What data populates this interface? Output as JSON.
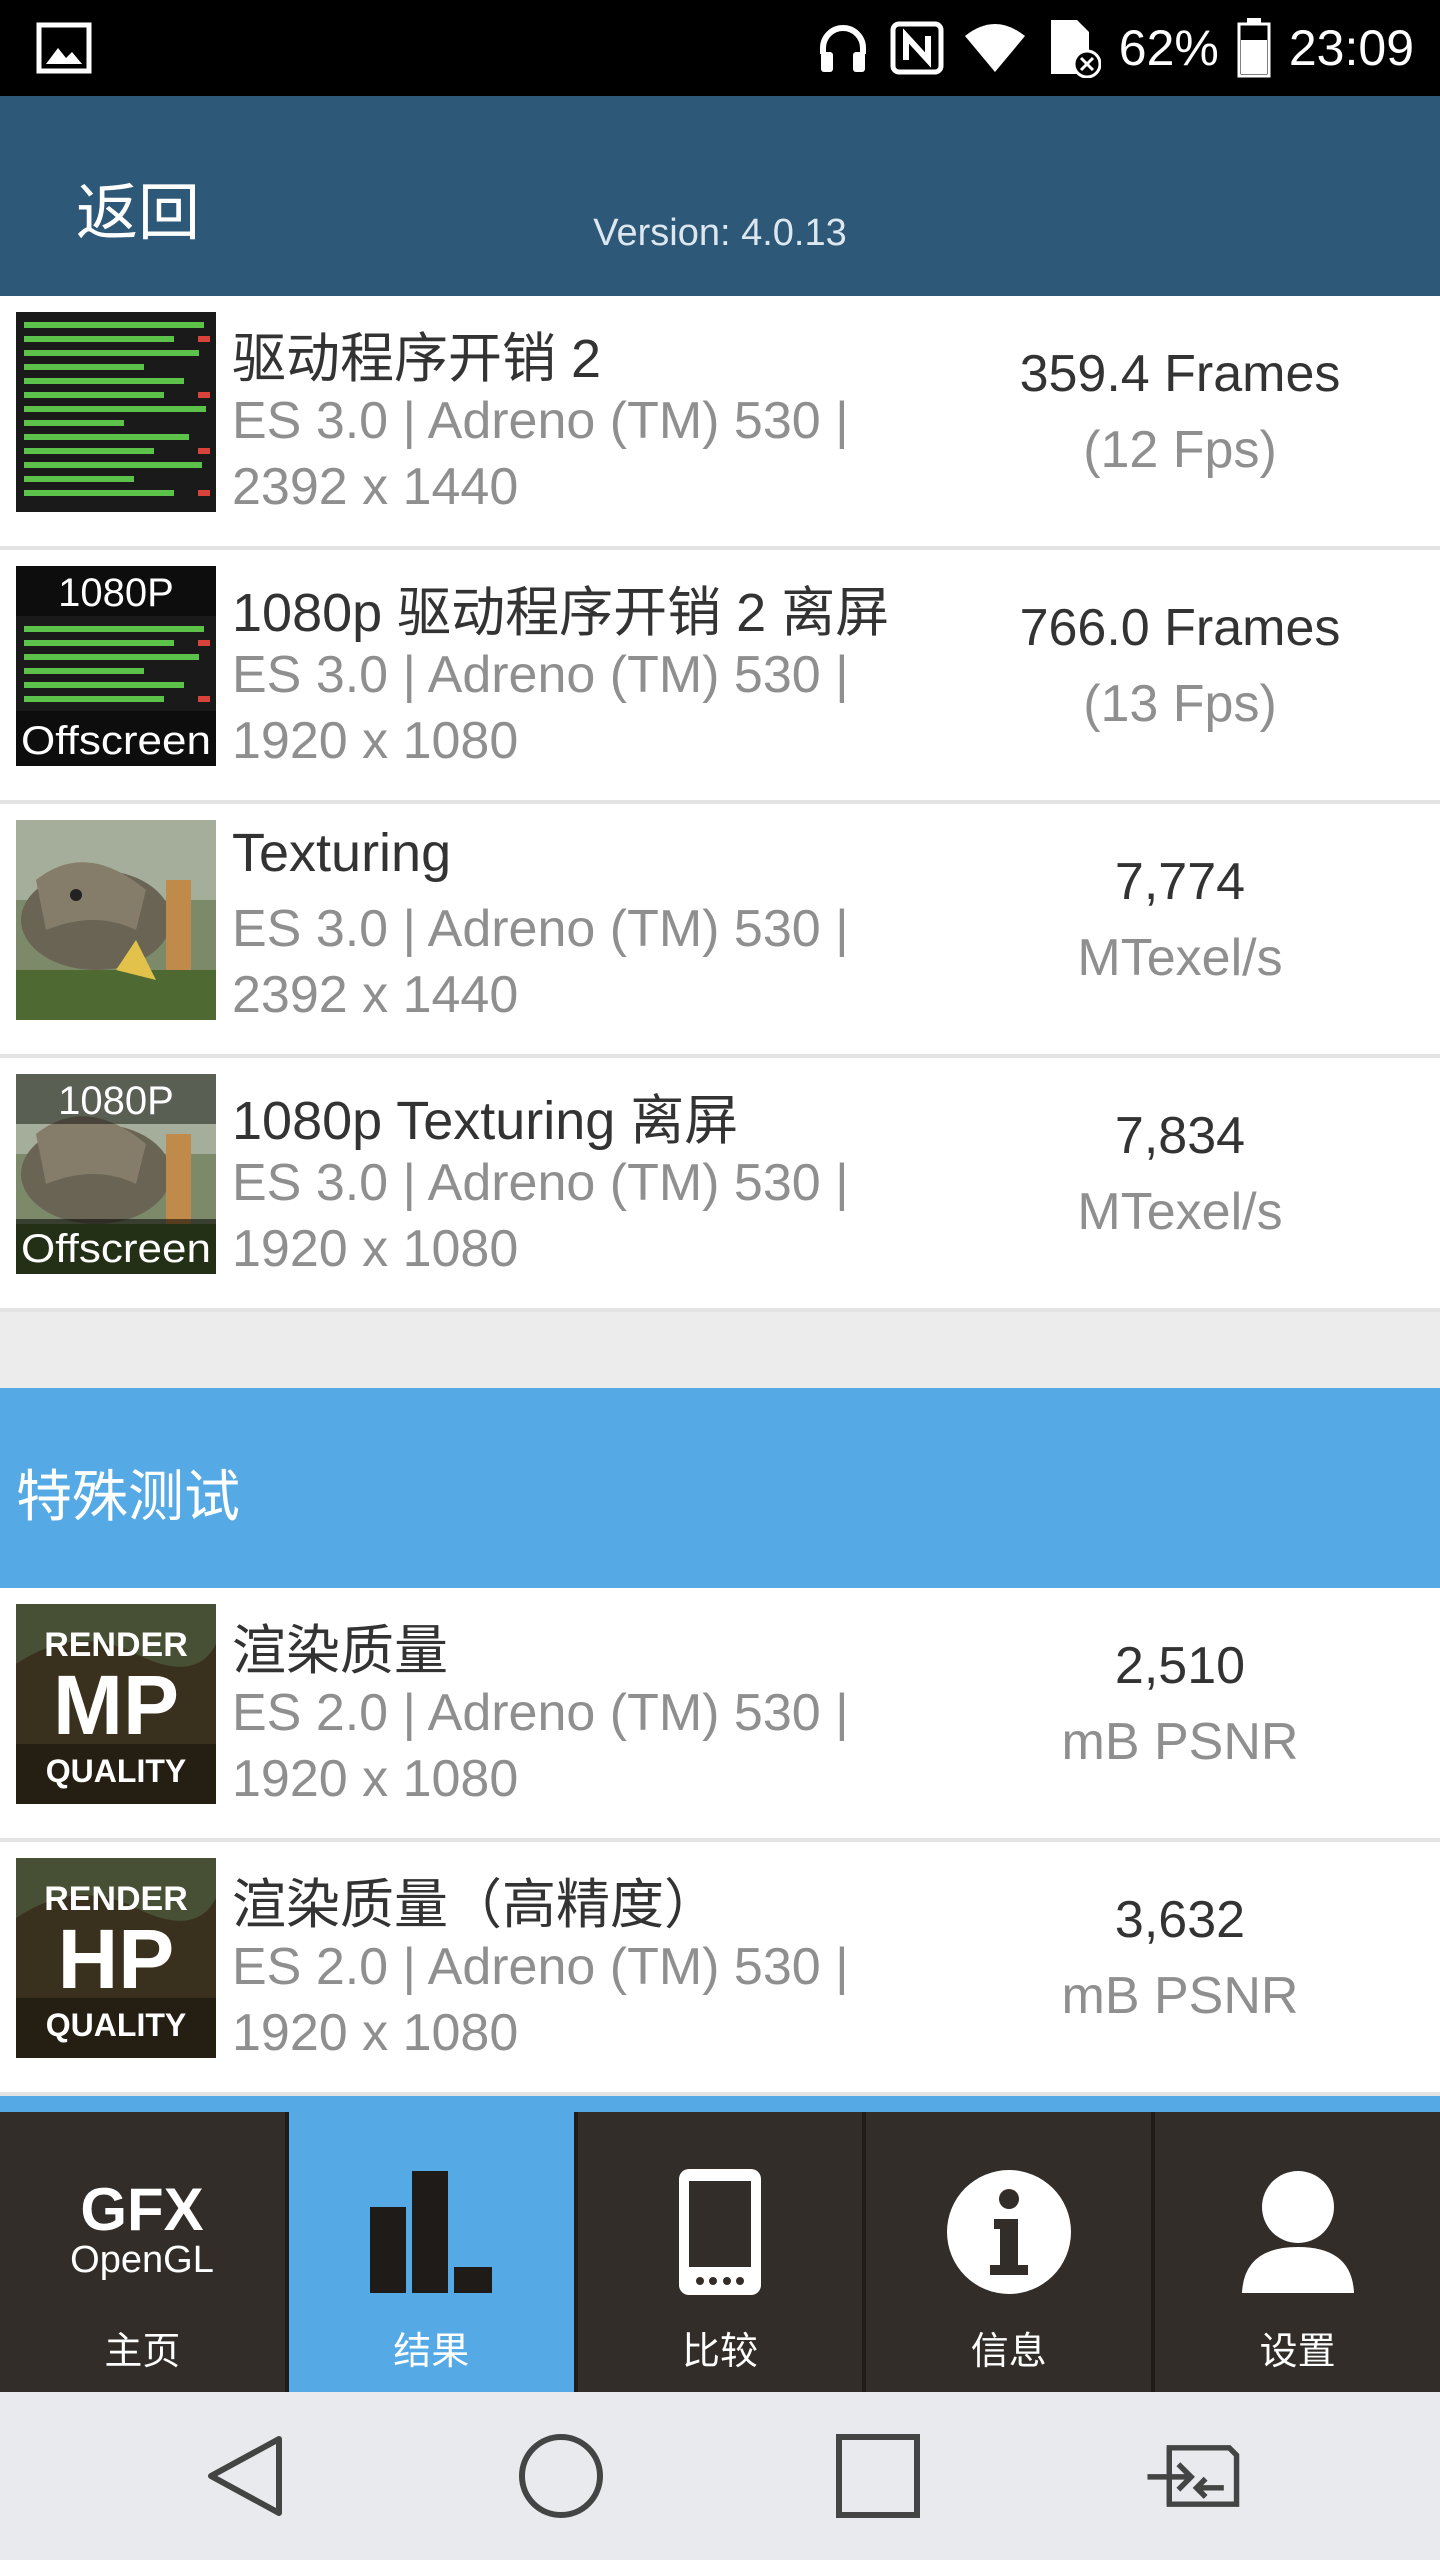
{
  "status_bar": {
    "battery": "62%",
    "time": "23:09"
  },
  "header": {
    "back_label": "返回",
    "version": "Version: 4.0.13"
  },
  "tests": [
    {
      "thumb": "driver-overhead",
      "title": "驱动程序开销 2",
      "sub": "ES 3.0 | Adreno (TM) 530 | 2392 x 1440",
      "value": "359.4 Frames",
      "unit": "(12 Fps)"
    },
    {
      "thumb": "driver-overhead-offscreen",
      "badge_top": "1080P",
      "badge_bottom": "Offscreen",
      "title": "1080p 驱动程序开销 2 离屏",
      "sub": "ES 3.0 | Adreno (TM) 530 | 1920 x 1080",
      "value": "766.0 Frames",
      "unit": "(13 Fps)"
    },
    {
      "thumb": "texturing",
      "title": "Texturing",
      "sub": "ES 3.0 | Adreno (TM) 530 | 2392 x 1440",
      "value": "7,774",
      "unit": "MTexel/s"
    },
    {
      "thumb": "texturing-offscreen",
      "badge_top": "1080P",
      "badge_bottom": "Offscreen",
      "title": "1080p Texturing 离屏",
      "sub": "ES 3.0 | Adreno (TM) 530 | 1920 x 1080",
      "value": "7,834",
      "unit": "MTexel/s"
    }
  ],
  "special_section": {
    "title": "特殊测试"
  },
  "special_tests": [
    {
      "thumb": "render-quality-mp",
      "badge_top": "RENDER",
      "badge_mid": "MP",
      "badge_bottom": "QUALITY",
      "title": "渲染质量",
      "sub": "ES 2.0 | Adreno (TM) 530 | 1920 x 1080",
      "value": "2,510",
      "unit": "mB PSNR"
    },
    {
      "thumb": "render-quality-hp",
      "badge_top": "RENDER",
      "badge_mid": "HP",
      "badge_bottom": "QUALITY",
      "title": "渲染质量（高精度）",
      "sub": "ES 2.0 | Adreno (TM) 530 | 1920 x 1080",
      "value": "3,632",
      "unit": "mB PSNR"
    }
  ],
  "tabs": [
    {
      "label": "主页",
      "icon": "gfx-opengl-logo",
      "logo_top": "GFX",
      "logo_bottom": "OpenGL",
      "active": false
    },
    {
      "label": "结果",
      "icon": "bar-chart-icon",
      "active": true
    },
    {
      "label": "比较",
      "icon": "phone-icon",
      "active": false
    },
    {
      "label": "信息",
      "icon": "info-icon",
      "active": false
    },
    {
      "label": "设置",
      "icon": "user-icon",
      "active": false
    }
  ],
  "nav": {
    "buttons": [
      "back-icon",
      "home-icon",
      "recents-icon",
      "switch-sim-icon"
    ]
  },
  "colors": {
    "header": "#2d5877",
    "accent": "#55aae6",
    "tab_bg": "#322d28"
  }
}
